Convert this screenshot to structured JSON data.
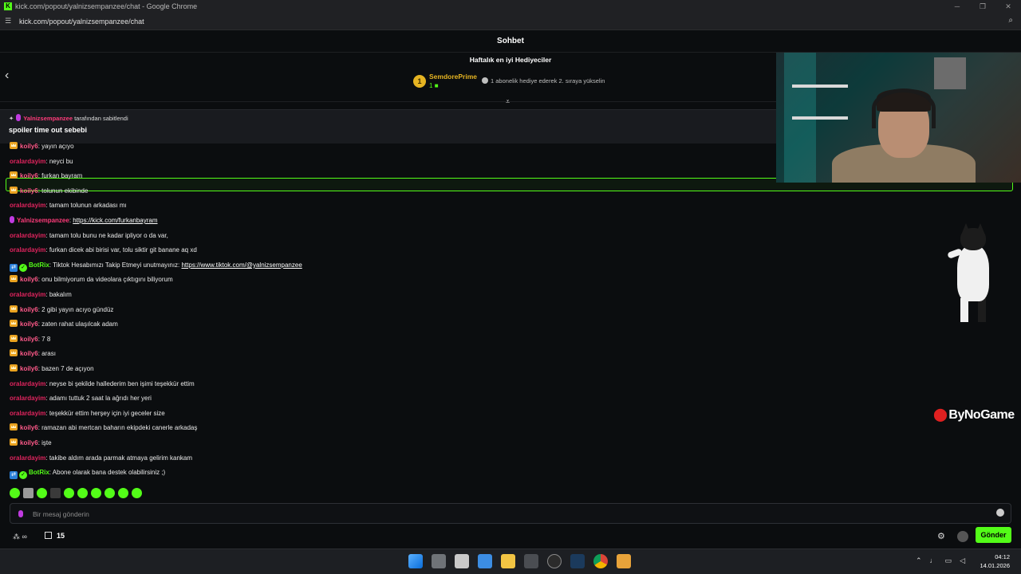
{
  "browser": {
    "window_title": "kick.com/popout/yalnizsempanzee/chat - Google Chrome",
    "url": "kick.com/popout/yalnizsempanzee/chat"
  },
  "chat": {
    "header_title": "Sohbet",
    "gifters": {
      "title": "Haftalık en iyi Hediyeciler",
      "rank": "1",
      "name": "SemdorePrime",
      "count": "1",
      "tip": "1 abonelik hediye ederek 2. sıraya yükselin"
    },
    "pinned": {
      "user": "Yalnizsempanzee",
      "suffix": "tarafından sabitlendi",
      "message": "spoiler time out sebebi"
    },
    "messages": [
      {
        "user": "koily6",
        "badge": "crown",
        "text": "yayın açıyo"
      },
      {
        "user": "oralardayim",
        "badge": "",
        "text": "neyci bu"
      },
      {
        "user": "koily6",
        "badge": "crown",
        "text": "furkan bayram"
      },
      {
        "user": "koily6",
        "badge": "crown",
        "text": "tolunun ekibinde"
      },
      {
        "user": "oralardayim",
        "badge": "",
        "text": "tamam tolunun arkadası mı"
      },
      {
        "user": "Yalnizsempanzee",
        "badge": "mic",
        "text": "",
        "link": "https://kick.com/furkanbayram"
      },
      {
        "user": "oralardayim",
        "badge": "",
        "text": "tamam tolu bunu ne kadar ipliyor o da var,"
      },
      {
        "user": "oralardayim",
        "badge": "",
        "text": "furkan dicek abi birisi var, tolu siktir git banane aq xd"
      },
      {
        "user": "BotRix",
        "badge": "bot",
        "text": "Tiktok Hesabımızı Takip Etmeyi unutmayınız:",
        "link": "https://www.tiktok.com/@yalnizsempanzee"
      },
      {
        "user": "koily6",
        "badge": "crown",
        "text": "onu bilmiyorum da videolara çıktıgını biliyorum"
      },
      {
        "user": "oralardayim",
        "badge": "",
        "text": "bakalım"
      },
      {
        "user": "koily6",
        "badge": "crown",
        "text": "2 gibi yayın acıyo gündüz"
      },
      {
        "user": "koily6",
        "badge": "crown",
        "text": "zaten rahat ulaşılcak adam"
      },
      {
        "user": "koily6",
        "badge": "crown",
        "text": "7 8"
      },
      {
        "user": "koily6",
        "badge": "crown",
        "text": "arası"
      },
      {
        "user": "koily6",
        "badge": "crown",
        "text": "bazen 7 de açıyon"
      },
      {
        "user": "oralardayim",
        "badge": "",
        "text": "neyse bi şekilde hallederim ben işimi teşekkür ettim"
      },
      {
        "user": "oralardayim",
        "badge": "",
        "text": "adamı tuttuk 2 saat la ağrıdı her yeri"
      },
      {
        "user": "oralardayim",
        "badge": "",
        "text": "teşekkür ettim herşey için iyi geceler size"
      },
      {
        "user": "koily6",
        "badge": "crown",
        "text": "ramazan abi mertcan baharın ekipdeki canerle arkadaş"
      },
      {
        "user": "koily6",
        "badge": "crown",
        "text": "işte"
      },
      {
        "user": "oralardayim",
        "badge": "",
        "text": "takibe aldım arada parmak atmaya gelirim kankam"
      },
      {
        "user": "BotRix",
        "badge": "bot",
        "text": "Abone olarak bana destek olabilirsiniz ;)"
      }
    ],
    "input_placeholder": "Bir mesaj gönderin",
    "points_symbol": "∞",
    "sub_count": "15",
    "send_label": "Gönder",
    "watermark": "ByNoGame"
  },
  "taskbar": {
    "time": "04:12",
    "date": "14.01.2026"
  },
  "colors": {
    "accent": "#53fc18",
    "background": "#0b0d0f",
    "username_red": "#e0245e",
    "gold": "#e6b422"
  }
}
